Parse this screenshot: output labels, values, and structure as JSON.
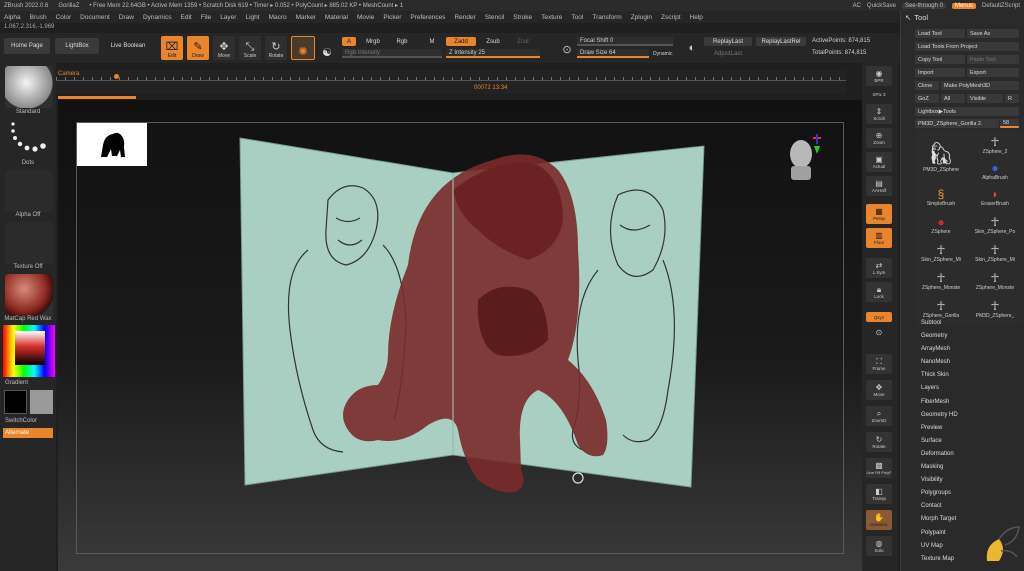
{
  "titlebar": {
    "app": "ZBrush 2022.0.6",
    "user": "GorillaZ",
    "freemem": "• Free Mem 22.64GB • Active Mem 1359 • Scratch Disk 619 • Timer ▸ 0.052 • PolyCount ▸ 885.02 KP • MeshCount ▸ 1",
    "ac": "AC",
    "quicksave": "QuickSave",
    "seethrough": "See-through  0",
    "menus": "Menus",
    "defaultzscript": "DefaultZScript"
  },
  "menubar": {
    "items": [
      "Alpha",
      "Brush",
      "Color",
      "Document",
      "Draw",
      "Dynamics",
      "Edit",
      "File",
      "Layer",
      "Light",
      "Macro",
      "Marker",
      "Material",
      "Movie",
      "Picker",
      "Preferences",
      "Render",
      "Stencil",
      "Stroke",
      "Texture",
      "Tool",
      "Transform",
      "Zplugin",
      "Zscript",
      "Help"
    ]
  },
  "coords": "1.067,2.316,-1.969",
  "toolbar": {
    "home_page": "Home Page",
    "lightbox": "LightBox",
    "live_boolean": "Live Boolean",
    "edit": "Edit",
    "draw": "Draw",
    "move": "Move",
    "scale": "Scale",
    "rotate": "Rotate",
    "a": "A",
    "mrgb": "Mrgb",
    "rgb": "Rgb",
    "m": "M",
    "zadd": "Zadd",
    "zsub": "Zsub",
    "zcut": "Zcut",
    "rgb_intensity": "Rgb Intensity",
    "z_intensity": "Z Intensity 25",
    "focal_shift": "Focal Shift 0",
    "draw_size": "Draw Size 64",
    "dynamic": "Dynamic",
    "replay_last": "ReplayLast",
    "replay_last_rel": "ReplayLastRel",
    "adjust_last": "AdjustLast",
    "active_points": "ActivePoints: 874,815",
    "total_points": "TotalPoints: 874,815"
  },
  "timeline": {
    "label": "Camera",
    "frame": "00072 13:34"
  },
  "leftshelf": {
    "brush": "Standard",
    "stroke": "Dots",
    "alpha": "Alpha Off",
    "texture": "Texture Off",
    "material": "MatCap Red Wax",
    "gradient": "Gradient",
    "switchcolor": "SwitchColor",
    "alternate": "Alternate"
  },
  "rightshelf": {
    "buttons": [
      "BPR",
      "SPix 3",
      "Scroll",
      "Zoom",
      "Actual",
      "AAHalf",
      "Persp",
      "Floor",
      "L.Sym",
      "Lock",
      "Qxyz",
      "Frame",
      "Move",
      "ZoomD",
      "Rotate",
      "Line Fill PolyF",
      "Transp",
      "Dynamic",
      "Solo"
    ]
  },
  "toolpanel": {
    "title": "Tool",
    "buttons": {
      "load_tool": "Load Tool",
      "save_as": "Save As",
      "load_tools_from_project": "Load Tools From Project",
      "copy_tool": "Copy Tool",
      "paste_tool": "Paste Tool",
      "import": "Import",
      "export": "Export",
      "clone": "Clone",
      "make_polymesh3d": "Make PolyMesh3D",
      "goz": "GoZ",
      "all": "All",
      "visible": "Visible",
      "r": "R",
      "lightbox_tools": "Lightbox▶Tools"
    },
    "current_tool": "PM3D_ZSphere_Gorilla 2.",
    "current_value": "58",
    "tools": [
      {
        "name": "PM3D_ZSphere",
        "icon": "gorilla-icon"
      },
      {
        "name": "ZSphere_2",
        "icon": "figure-icon"
      },
      {
        "name": "AlphaBrush",
        "icon": "sphere-icon"
      },
      {
        "name": "SimpleBrush",
        "icon": "s-brush-icon"
      },
      {
        "name": "EraserBrush",
        "icon": "eraser-icon"
      },
      {
        "name": "ZSphere",
        "icon": "sphere-icon"
      },
      {
        "name": "Skin_ZSphere_Po",
        "icon": "figure-icon"
      },
      {
        "name": "Skin_ZSphere_Mi",
        "icon": "figure-icon"
      },
      {
        "name": "Skin_ZSphere_Mi",
        "icon": "figure-icon"
      },
      {
        "name": "ZSphere_Monste",
        "icon": "figure-icon"
      },
      {
        "name": "ZSphere_Monste",
        "icon": "figure-icon"
      },
      {
        "name": "ZSphere_Gorilla",
        "icon": "figure-icon"
      },
      {
        "name": "PM3D_ZSphere_",
        "icon": "figure-icon"
      }
    ],
    "sections": [
      "Subtool",
      "Geometry",
      "ArrayMesh",
      "NanoMesh",
      "Thick Skin",
      "Layers",
      "FiberMesh",
      "Geometry HD",
      "Preview",
      "Surface",
      "Deformation",
      "Masking",
      "Visibility",
      "Polygroups",
      "Contact",
      "Morph Target",
      "Polypaint",
      "UV Map",
      "Texture Map"
    ]
  },
  "colors": {
    "accent": "#e9852d",
    "panel": "#262626",
    "plane": "#a9cfc3",
    "wax": "#7a2a2a"
  }
}
